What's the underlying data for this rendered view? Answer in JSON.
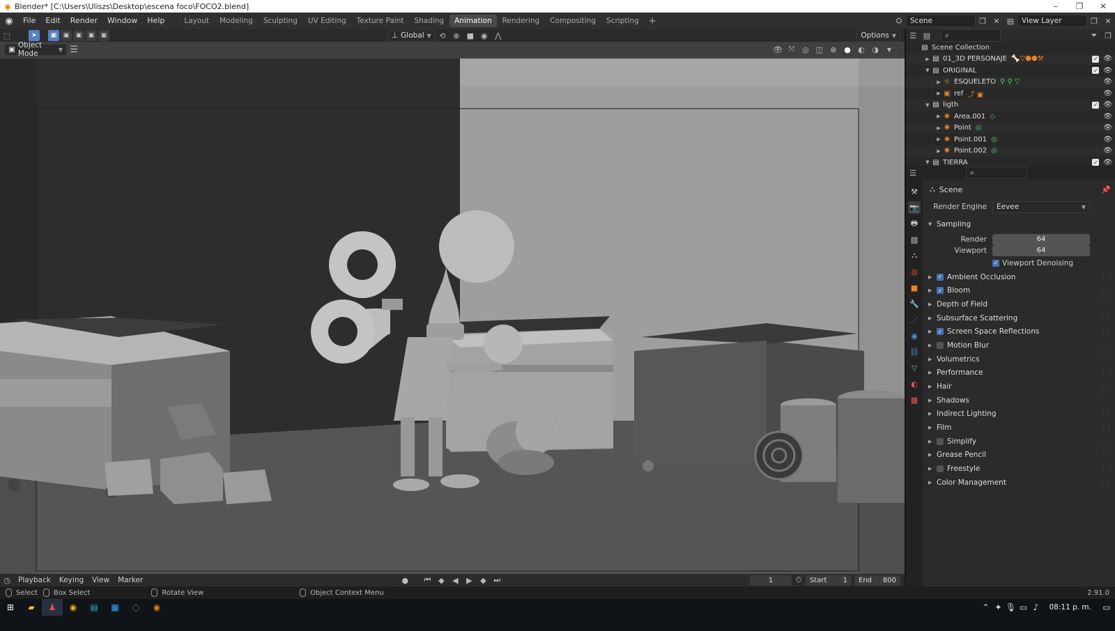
{
  "titlebar": {
    "title": "Blender* [C:\\Users\\Uliszs\\Desktop\\escena foco\\FOCO2.blend]",
    "minimize": "–",
    "restore": "❐",
    "close": "✕"
  },
  "menubar": {
    "menus": [
      "File",
      "Edit",
      "Render",
      "Window",
      "Help"
    ],
    "workspaces": [
      "Layout",
      "Modeling",
      "Sculpting",
      "UV Editing",
      "Texture Paint",
      "Shading",
      "Animation",
      "Rendering",
      "Compositing",
      "Scripting"
    ],
    "active_workspace": "Animation",
    "add_workspace": "+",
    "scene": "Scene",
    "view_layer": "View Layer"
  },
  "viewport": {
    "transform_orientation": "Global",
    "options_label": "Options",
    "mode": "Object Mode"
  },
  "timeline": {
    "menus": [
      "Playback",
      "Keying",
      "View",
      "Marker"
    ],
    "current_frame": "1",
    "start_label": "Start",
    "start_value": "1",
    "end_label": "End",
    "end_value": "800"
  },
  "statusbar": {
    "select": "Select",
    "box_select": "Box Select",
    "rotate_view": "Rotate View",
    "context_menu": "Object Context Menu",
    "version": "2.91.0"
  },
  "taskbar": {
    "time": "08:11 p. m."
  },
  "outliner": {
    "rows": [
      {
        "indent": 0,
        "arrow": "",
        "icon": "scene-collection-icon",
        "label": "Scene Collection",
        "extra": "",
        "check": false,
        "eye": false
      },
      {
        "indent": 1,
        "arrow": "▶",
        "icon": "collection-icon",
        "label": "01_3D PERSONAJE",
        "extra": "🦴▽⬢⬢⚒",
        "check": true,
        "eye": true
      },
      {
        "indent": 1,
        "arrow": "▼",
        "icon": "collection-icon",
        "label": "ORIGINAL",
        "extra": "",
        "check": true,
        "eye": true
      },
      {
        "indent": 2,
        "arrow": "▶",
        "icon": "armature-icon",
        "label": "ESQUELETO",
        "extra": "⚲ ⚲ ▽",
        "check": false,
        "eye": true
      },
      {
        "indent": 2,
        "arrow": "▶",
        "icon": "image-empty-icon",
        "label": "ref",
        "extra": "⤴ ▣",
        "check": false,
        "eye": true
      },
      {
        "indent": 1,
        "arrow": "▼",
        "icon": "collection-icon",
        "label": "ligth",
        "extra": "",
        "check": true,
        "eye": true
      },
      {
        "indent": 2,
        "arrow": "▶",
        "icon": "light-icon",
        "label": "Area.001",
        "extra": "◇",
        "check": false,
        "eye": true
      },
      {
        "indent": 2,
        "arrow": "▶",
        "icon": "light-icon",
        "label": "Point",
        "extra": "◎",
        "check": false,
        "eye": true
      },
      {
        "indent": 2,
        "arrow": "▶",
        "icon": "light-icon",
        "label": "Point.001",
        "extra": "◎",
        "check": false,
        "eye": true
      },
      {
        "indent": 2,
        "arrow": "▶",
        "icon": "light-icon",
        "label": "Point.002",
        "extra": "◎",
        "check": false,
        "eye": true
      },
      {
        "indent": 1,
        "arrow": "▼",
        "icon": "collection-icon",
        "label": "TIERRA",
        "extra": "",
        "check": true,
        "eye": true
      }
    ]
  },
  "properties": {
    "context": "Scene",
    "render_engine_label": "Render Engine",
    "render_engine": "Eevee",
    "sampling_label": "Sampling",
    "render_label": "Render",
    "render_samples": "64",
    "viewport_label": "Viewport",
    "viewport_samples": "64",
    "viewport_denoising": "Viewport Denoising",
    "panels": [
      {
        "label": "Ambient Occlusion",
        "check": "on"
      },
      {
        "label": "Bloom",
        "check": "on"
      },
      {
        "label": "Depth of Field",
        "check": "none"
      },
      {
        "label": "Subsurface Scattering",
        "check": "none"
      },
      {
        "label": "Screen Space Reflections",
        "check": "on"
      },
      {
        "label": "Motion Blur",
        "check": "off"
      },
      {
        "label": "Volumetrics",
        "check": "none"
      },
      {
        "label": "Performance",
        "check": "none"
      },
      {
        "label": "Hair",
        "check": "none"
      },
      {
        "label": "Shadows",
        "check": "none"
      },
      {
        "label": "Indirect Lighting",
        "check": "none"
      },
      {
        "label": "Film",
        "check": "none"
      },
      {
        "label": "Simplify",
        "check": "off"
      },
      {
        "label": "Grease Pencil",
        "check": "none"
      },
      {
        "label": "Freestyle",
        "check": "off"
      },
      {
        "label": "Color Management",
        "check": "none"
      }
    ]
  },
  "colors": {
    "accent": "#4772b3",
    "active_workspace": "#4a4a4a",
    "orange_icon": "#e8832a",
    "green_icon": "#5ec76a"
  }
}
